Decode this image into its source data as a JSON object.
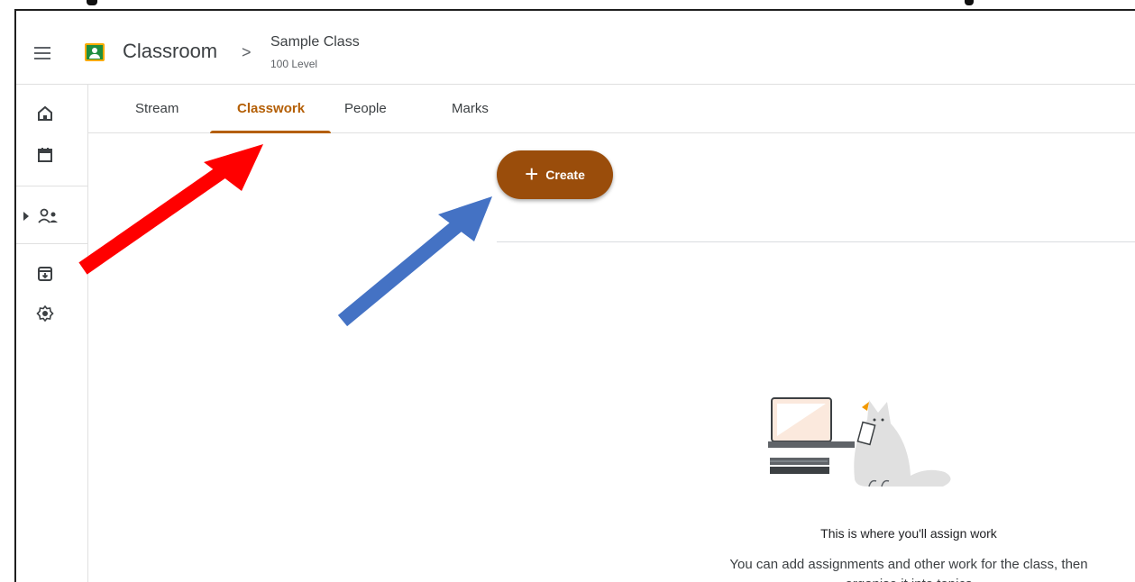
{
  "header": {
    "app_title": "Classroom",
    "separator": ">",
    "class_name": "Sample Class",
    "class_section": "100 Level"
  },
  "tabs": [
    {
      "label": "Stream",
      "active": false
    },
    {
      "label": "Classwork",
      "active": true
    },
    {
      "label": "People",
      "active": false
    },
    {
      "label": "Marks",
      "active": false
    }
  ],
  "rail": {
    "icons": [
      "home-icon",
      "calendar-icon",
      "enrolled-classes-icon",
      "archive-icon",
      "settings-icon"
    ]
  },
  "create_button": {
    "label": "Create",
    "icon": "plus-icon"
  },
  "empty_state": {
    "title": "This is where you'll assign work",
    "description": "You can add assignments and other work for the class, then organise it into topics"
  },
  "colors": {
    "accent": "#b45f06",
    "create_button": "#9a4d0b",
    "annotation_red": "#ff0000",
    "annotation_blue": "#4472c4"
  }
}
